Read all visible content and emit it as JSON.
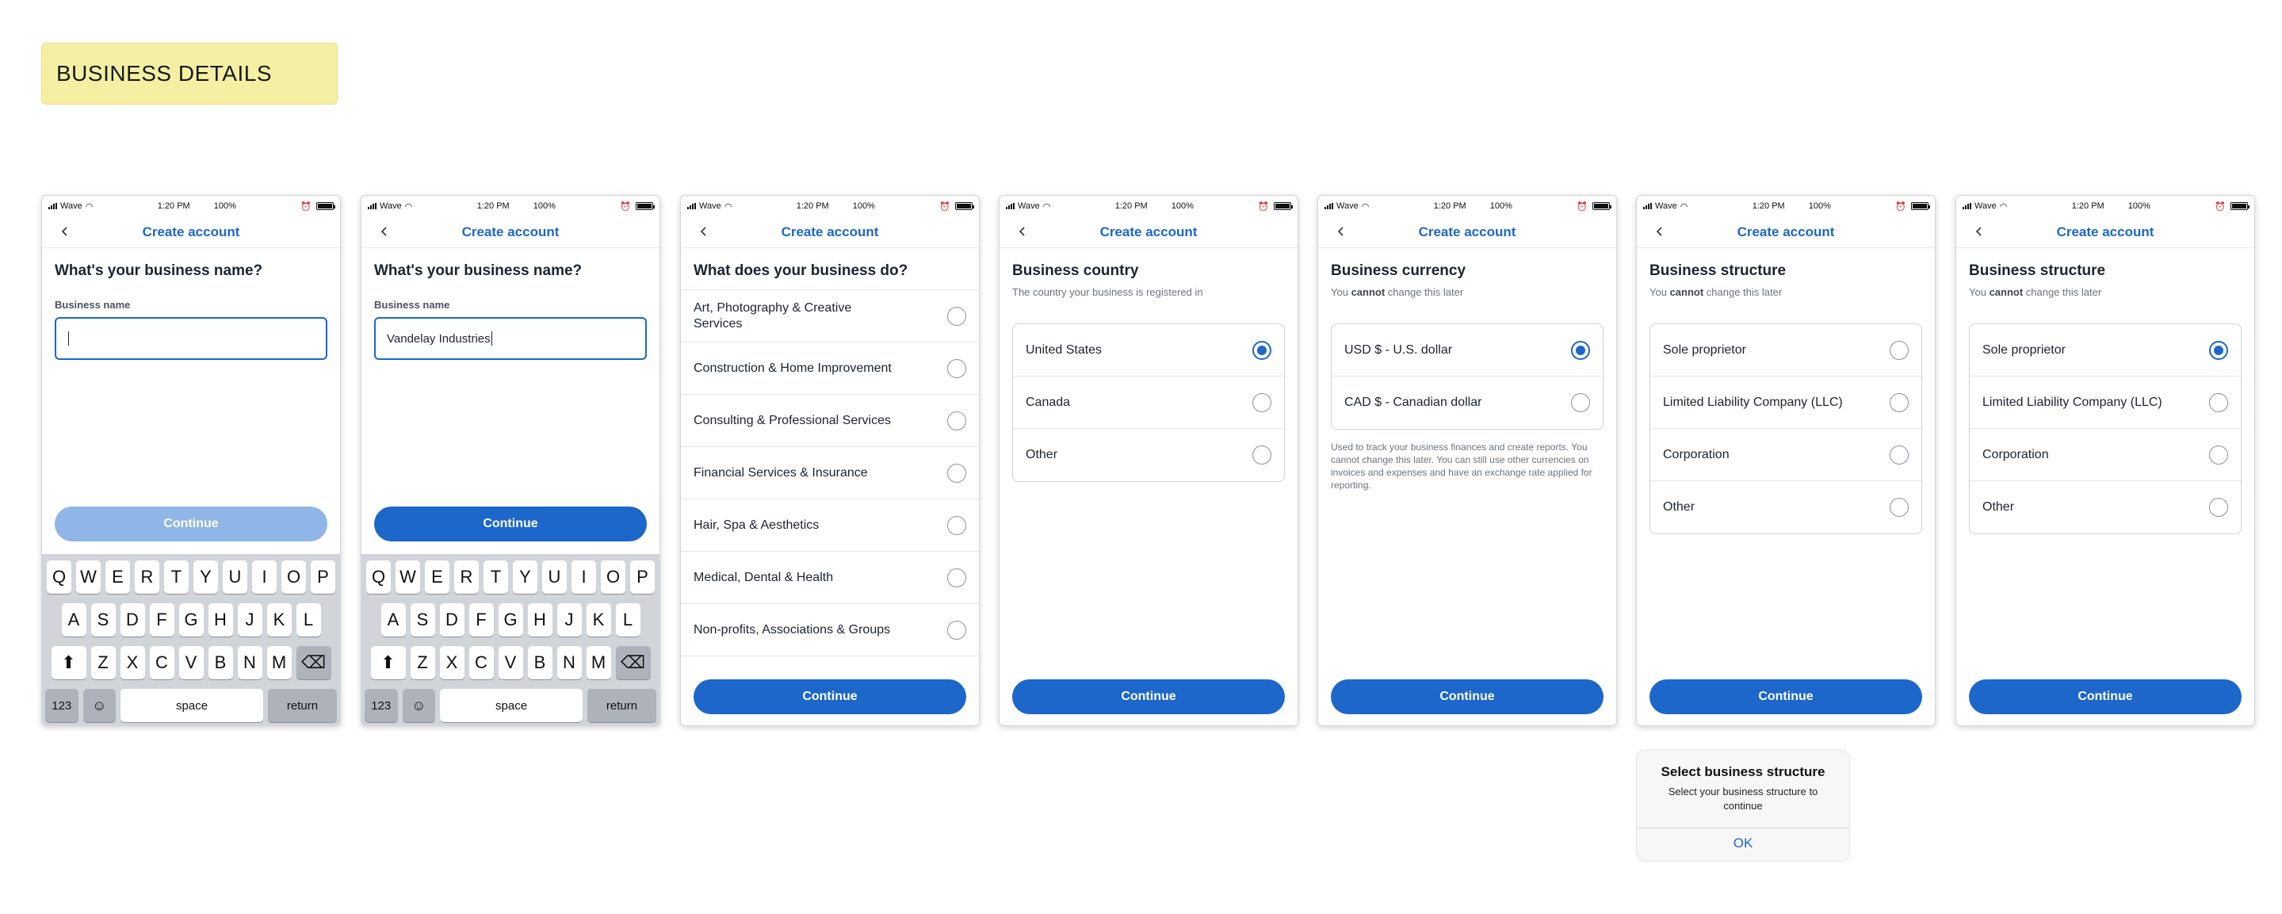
{
  "section_label": "BUSINESS DETAILS",
  "status_bar": {
    "carrier": "Wave",
    "time": "1:20 PM",
    "battery": "100%"
  },
  "nav_title": "Create account",
  "cta_label": "Continue",
  "keyboard": {
    "row1": [
      "Q",
      "W",
      "E",
      "R",
      "T",
      "Y",
      "U",
      "I",
      "O",
      "P"
    ],
    "row2": [
      "A",
      "S",
      "D",
      "F",
      "G",
      "H",
      "J",
      "K",
      "L"
    ],
    "row3": [
      "Z",
      "X",
      "C",
      "V",
      "B",
      "N",
      "M"
    ],
    "numbers": "123",
    "space": "space",
    "return": "return"
  },
  "screen1": {
    "heading": "What's your business name?",
    "field_label": "Business name",
    "value": ""
  },
  "screen2": {
    "heading": "What's your business name?",
    "field_label": "Business name",
    "value": "Vandelay Industries"
  },
  "screen3": {
    "heading": "What does your business do?",
    "options": [
      "Art, Photography & Creative Services",
      "Construction & Home Improvement",
      "Consulting & Professional Services",
      "Financial Services & Insurance",
      "Hair, Spa & Aesthetics",
      "Medical, Dental & Health",
      "Non-profits, Associations & Groups"
    ]
  },
  "screen4": {
    "heading": "Business country",
    "subtext": "The country your business is registered in",
    "options": [
      "United States",
      "Canada",
      "Other"
    ],
    "selected": "United States"
  },
  "screen5": {
    "heading": "Business currency",
    "subtext_pre": "You ",
    "subtext_bold": "cannot",
    "subtext_post": " change this later",
    "options": [
      "USD $ - U.S. dollar",
      "CAD $ - Canadian dollar"
    ],
    "selected": "USD $ - U.S. dollar",
    "note": "Used to track your business finances and create reports. You cannot change this later. You can still use other currencies on invoices and expenses and have an exchange rate applied for reporting."
  },
  "screen6": {
    "heading": "Business structure",
    "subtext_pre": "You ",
    "subtext_bold": "cannot",
    "subtext_post": " change this later",
    "options": [
      "Sole proprietor",
      "Limited Liability Company (LLC)",
      "Corporation",
      "Other"
    ],
    "selected": ""
  },
  "screen7": {
    "heading": "Business structure",
    "subtext_pre": "You ",
    "subtext_bold": "cannot",
    "subtext_post": " change this later",
    "options": [
      "Sole proprietor",
      "Limited Liability Company (LLC)",
      "Corporation",
      "Other"
    ],
    "selected": "Sole proprietor"
  },
  "alert": {
    "title": "Select business structure",
    "message": "Select your business structure to continue",
    "ok": "OK"
  },
  "colors": {
    "accent": "#1c67c9",
    "accent_disabled": "#8fb6e6",
    "banner": "#f4f0a3"
  }
}
